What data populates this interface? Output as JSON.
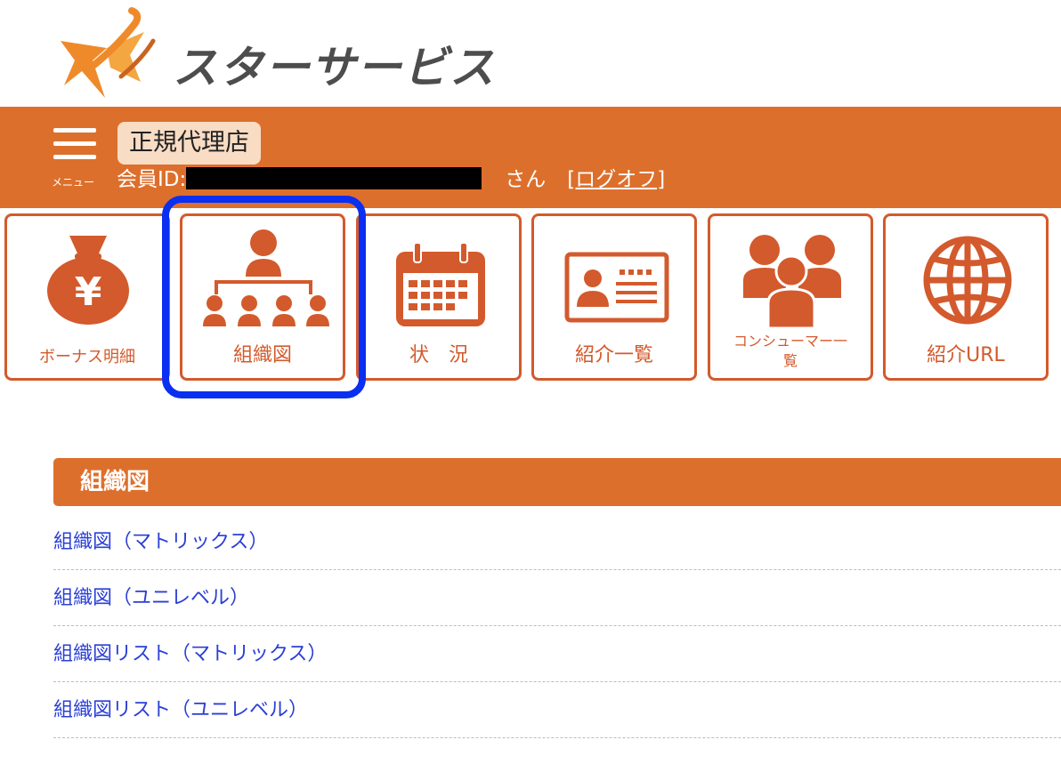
{
  "brand": {
    "name": "スターサービス",
    "accent_color": "#dd6f2c",
    "icon_color": "#d35a2c",
    "highlight_color": "#0a2ff0",
    "link_color": "#2a3fd6"
  },
  "header": {
    "menu_label": "メニュー",
    "rank": "正規代理店",
    "member_label": "会員ID:",
    "suffix": "さん",
    "logoff": "[ログオフ]"
  },
  "tiles": [
    {
      "label": "ボーナス明細",
      "icon": "money-bag-yen-icon"
    },
    {
      "label": "組織図",
      "icon": "org-chart-icon",
      "highlighted": true
    },
    {
      "label": "状　況",
      "icon": "calendar-icon"
    },
    {
      "label": "紹介一覧",
      "icon": "id-card-icon"
    },
    {
      "label": "コンシューマー一覧",
      "icon": "people-group-icon"
    },
    {
      "label": "紹介URL",
      "icon": "globe-icon"
    }
  ],
  "section": {
    "title": "組織図",
    "links": [
      "組織図（マトリックス）",
      "組織図（ユニレベル）",
      "組織図リスト（マトリックス）",
      "組織図リスト（ユニレベル）"
    ]
  }
}
